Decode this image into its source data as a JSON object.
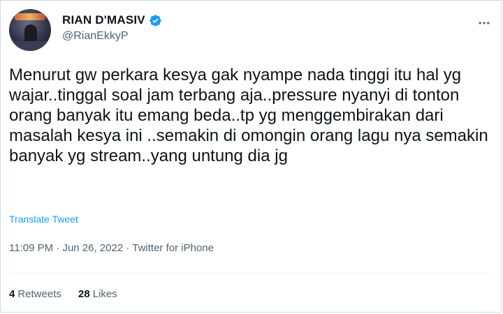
{
  "author": {
    "display_name": "RIAN D'MASIV",
    "handle": "@RianEkkyP",
    "verified": true,
    "avatar_icon": "profile-photo-avatar",
    "verified_icon": "verified-badge-icon",
    "verified_color": "#1d9bf0"
  },
  "more_icon": "more-horizontal-icon",
  "tweet": {
    "text": "Menurut gw perkara kesya gak nyampe nada tinggi itu hal yg wajar..tinggal soal jam terbang aja..pressure nyanyi di tonton orang banyak itu emang beda..tp yg menggembirakan dari masalah kesya ini ..semakin di omongin orang lagu nya semakin banyak yg stream..yang untung dia jg",
    "translate_label": "Translate Tweet"
  },
  "meta": {
    "time": "11:09 PM",
    "separator": " · ",
    "date": "Jun 26, 2022",
    "source": "Twitter for iPhone"
  },
  "stats": {
    "retweets_count": "4",
    "retweets_label": "Retweets",
    "likes_count": "28",
    "likes_label": "Likes"
  },
  "colors": {
    "link": "#1d9bf0",
    "secondary_text": "#536471",
    "primary_text": "#0f1419",
    "border": "#cfd9de"
  }
}
